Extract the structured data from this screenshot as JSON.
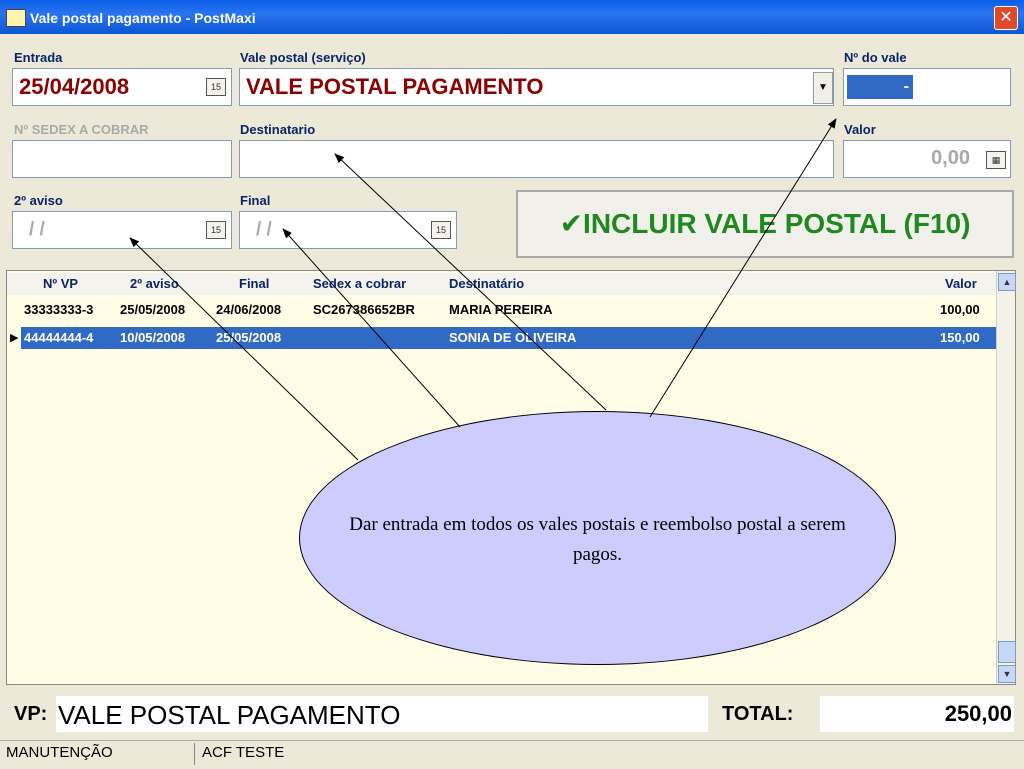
{
  "window": {
    "title": "Vale postal pagamento - PostMaxi"
  },
  "fields": {
    "entrada": {
      "label": "Entrada",
      "value": "25/04/2008"
    },
    "vale_postal": {
      "label": "Vale postal (serviço)",
      "value": "VALE POSTAL PAGAMENTO"
    },
    "num_vale": {
      "label": "Nº do vale",
      "value": "-"
    },
    "sedex": {
      "label": "Nº SEDEX A COBRAR",
      "value": ""
    },
    "destinatario": {
      "label": "Destinatario",
      "value": ""
    },
    "valor": {
      "label": "Valor",
      "value": "0,00"
    },
    "segundo_aviso": {
      "label": "2º aviso",
      "value": "/ /"
    },
    "final": {
      "label": "Final",
      "value": "/ /"
    }
  },
  "calendar_icon": "15",
  "incluir_button": "✔INCLUIR VALE POSTAL (F10)",
  "table": {
    "headers": [
      "Nº VP",
      "2º aviso",
      "Final",
      "Sedex a cobrar",
      "Destinatário",
      "Valor"
    ],
    "rows": [
      {
        "vp": "33333333-3",
        "aviso": "25/05/2008",
        "final": "24/06/2008",
        "sedex": "SC267386652BR",
        "dest": "MARIA PEREIRA",
        "valor": "100,00",
        "selected": false
      },
      {
        "vp": "44444444-4",
        "aviso": "10/05/2008",
        "final": "25/05/2008",
        "sedex": "",
        "dest": "SONIA DE OLIVEIRA",
        "valor": "150,00",
        "selected": true
      }
    ]
  },
  "bottom": {
    "vp_label": "VP:",
    "vp_value": "VALE POSTAL PAGAMENTO",
    "total_label": "TOTAL:",
    "total_value": "250,00"
  },
  "status": {
    "left": "MANUTENÇÃO",
    "right": "ACF TESTE"
  },
  "callout": {
    "text": "Dar entrada em todos os vales postais e reembolso postal a serem pagos."
  },
  "colors": {
    "titlebar": "#0a5ee8",
    "selected_row": "#316ac5",
    "grid_bg": "#fffde6",
    "callout_fill": "#ccccff",
    "date_text": "#8b0000",
    "incluir_text": "#1e8a1e"
  }
}
